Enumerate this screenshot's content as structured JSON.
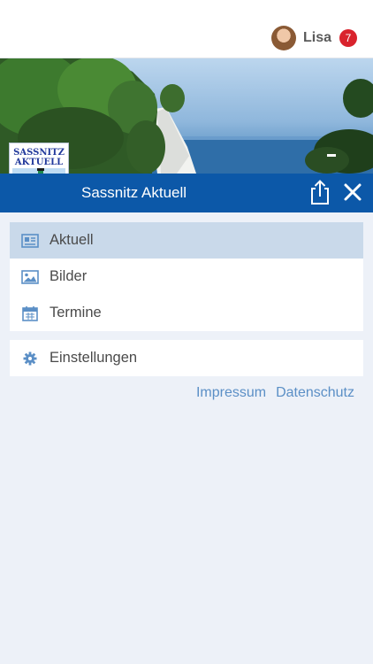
{
  "header": {
    "user_name": "Lisa",
    "notification_count": "7",
    "avatar_icon": "user-avatar"
  },
  "banner": {
    "logo_line1": "SASSNITZ",
    "logo_line2": "AKTUELL",
    "title": "Sassnitz Aktuell",
    "share_icon": "share-icon",
    "close_icon": "close-icon"
  },
  "menu": {
    "items": [
      {
        "label": "Aktuell",
        "icon": "newspaper-icon",
        "active": true
      },
      {
        "label": "Bilder",
        "icon": "image-icon",
        "active": false
      },
      {
        "label": "Termine",
        "icon": "calendar-icon",
        "active": false
      }
    ],
    "settings": {
      "label": "Einstellungen",
      "icon": "gear-icon"
    }
  },
  "footer": {
    "impressum": "Impressum",
    "datenschutz": "Datenschutz"
  },
  "colors": {
    "titlebar": "#0c58a8",
    "active_item": "#c9d9ea",
    "link": "#5b8fc6",
    "badge": "#d9232d",
    "background": "#edf1f8"
  }
}
